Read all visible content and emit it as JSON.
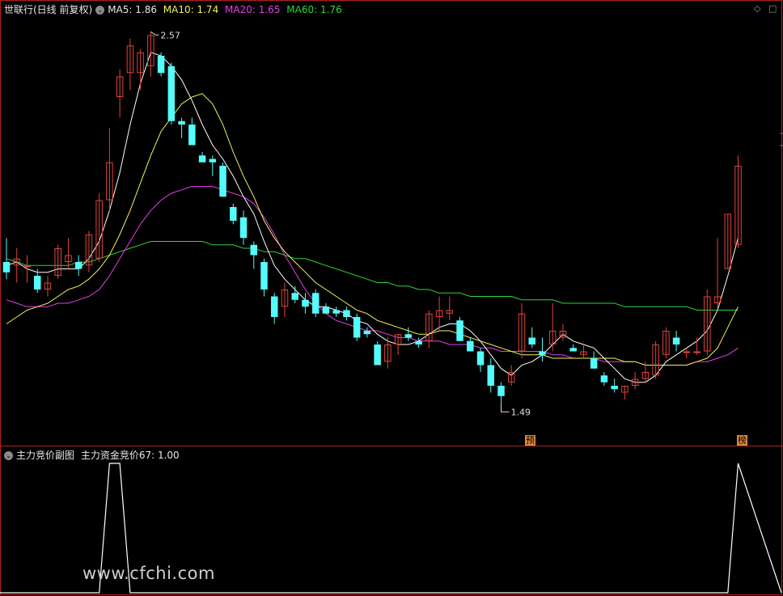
{
  "main_legend": {
    "title": "世联行(日线 前复权)",
    "ma5": "MA5: 1.86",
    "ma10": "MA10: 1.74",
    "ma20": "MA20: 1.65",
    "ma60": "MA60: 1.76"
  },
  "sub_legend": {
    "title": "主力竞价副图",
    "value": "主力资金竞价67: 1.00"
  },
  "annotations": {
    "high": "2.57",
    "low": "1.49",
    "tag_yu": "预",
    "tag_bang": "榜"
  },
  "watermark": "www.cfchi.com",
  "colors": {
    "up": "#e0443c",
    "down": "#54fcfc",
    "ma5": "#ffffff",
    "ma10": "#f2f25a",
    "ma20": "#e83ce8",
    "ma60": "#2ed63a",
    "border": "#b02020",
    "indicator": "#ffffff"
  },
  "chart_data": [
    {
      "type": "candlestick",
      "series_name": "世联行(日线 前复权)",
      "ohlc": [
        [
          1.9,
          1.97,
          1.85,
          1.87
        ],
        [
          1.89,
          1.94,
          1.84,
          1.91
        ],
        [
          1.89,
          1.92,
          1.84,
          1.89
        ],
        [
          1.86,
          1.88,
          1.81,
          1.82
        ],
        [
          1.82,
          1.86,
          1.8,
          1.84
        ],
        [
          1.86,
          1.95,
          1.85,
          1.94
        ],
        [
          1.9,
          1.97,
          1.88,
          1.92
        ],
        [
          1.9,
          1.92,
          1.86,
          1.88
        ],
        [
          1.89,
          1.99,
          1.87,
          1.98
        ],
        [
          1.91,
          2.1,
          1.9,
          2.08
        ],
        [
          2.08,
          2.29,
          2.05,
          2.19
        ],
        [
          2.38,
          2.46,
          2.32,
          2.44
        ],
        [
          2.45,
          2.55,
          2.4,
          2.53
        ],
        [
          2.45,
          2.52,
          2.4,
          2.51
        ],
        [
          2.47,
          2.57,
          2.44,
          2.56
        ],
        [
          2.5,
          2.51,
          2.44,
          2.45
        ],
        [
          2.47,
          2.48,
          2.3,
          2.31
        ],
        [
          2.31,
          2.32,
          2.26,
          2.3
        ],
        [
          2.3,
          2.32,
          2.25,
          2.24
        ],
        [
          2.21,
          2.22,
          2.2,
          2.19
        ],
        [
          2.2,
          2.21,
          2.15,
          2.19
        ],
        [
          2.18,
          2.19,
          2.09,
          2.09
        ],
        [
          2.06,
          2.07,
          2.01,
          2.02
        ],
        [
          2.03,
          2.05,
          1.95,
          1.97
        ],
        [
          1.95,
          1.96,
          1.88,
          1.92
        ],
        [
          1.9,
          1.91,
          1.8,
          1.82
        ],
        [
          1.8,
          1.81,
          1.72,
          1.74
        ],
        [
          1.77,
          1.84,
          1.74,
          1.82
        ],
        [
          1.81,
          1.83,
          1.78,
          1.79
        ],
        [
          1.79,
          1.81,
          1.75,
          1.77
        ],
        [
          1.81,
          1.82,
          1.74,
          1.75
        ],
        [
          1.77,
          1.78,
          1.75,
          1.75
        ],
        [
          1.76,
          1.77,
          1.74,
          1.75
        ],
        [
          1.76,
          1.77,
          1.73,
          1.74
        ],
        [
          1.74,
          1.75,
          1.67,
          1.68
        ],
        [
          1.7,
          1.71,
          1.68,
          1.69
        ],
        [
          1.66,
          1.67,
          1.6,
          1.6
        ],
        [
          1.61,
          1.68,
          1.59,
          1.66
        ],
        [
          1.66,
          1.69,
          1.63,
          1.69
        ],
        [
          1.69,
          1.71,
          1.67,
          1.68
        ],
        [
          1.67,
          1.68,
          1.65,
          1.66
        ],
        [
          1.67,
          1.76,
          1.65,
          1.75
        ],
        [
          1.74,
          1.8,
          1.7,
          1.76
        ],
        [
          1.75,
          1.8,
          1.73,
          1.76
        ],
        [
          1.73,
          1.74,
          1.67,
          1.67
        ],
        [
          1.67,
          1.68,
          1.64,
          1.64
        ],
        [
          1.64,
          1.65,
          1.58,
          1.6
        ],
        [
          1.6,
          1.62,
          1.52,
          1.54
        ],
        [
          1.54,
          1.55,
          1.49,
          1.51
        ],
        [
          1.55,
          1.6,
          1.54,
          1.58
        ],
        [
          1.64,
          1.78,
          1.62,
          1.75
        ],
        [
          1.68,
          1.71,
          1.65,
          1.66
        ],
        [
          1.64,
          1.68,
          1.61,
          1.63
        ],
        [
          1.66,
          1.78,
          1.64,
          1.7
        ],
        [
          1.68,
          1.72,
          1.67,
          1.7
        ],
        [
          1.65,
          1.66,
          1.64,
          1.64
        ],
        [
          1.63,
          1.66,
          1.62,
          1.64
        ],
        [
          1.62,
          1.64,
          1.59,
          1.59
        ],
        [
          1.57,
          1.58,
          1.54,
          1.55
        ],
        [
          1.54,
          1.56,
          1.52,
          1.53
        ],
        [
          1.52,
          1.54,
          1.5,
          1.54
        ],
        [
          1.54,
          1.58,
          1.53,
          1.56
        ],
        [
          1.56,
          1.61,
          1.55,
          1.58
        ],
        [
          1.57,
          1.67,
          1.56,
          1.66
        ],
        [
          1.63,
          1.71,
          1.62,
          1.7
        ],
        [
          1.68,
          1.7,
          1.64,
          1.66
        ],
        [
          1.64,
          1.65,
          1.62,
          1.64
        ],
        [
          1.64,
          1.68,
          1.63,
          1.64
        ],
        [
          1.64,
          1.82,
          1.63,
          1.8
        ],
        [
          1.78,
          1.97,
          1.76,
          1.8
        ],
        [
          1.88,
          2.04,
          1.88,
          2.04
        ],
        [
          1.95,
          2.21,
          1.94,
          2.18
        ]
      ],
      "ma5": [
        1.89,
        1.9,
        1.88,
        1.87,
        1.87,
        1.88,
        1.88,
        1.88,
        1.91,
        1.96,
        2.05,
        2.16,
        2.3,
        2.42,
        2.51,
        2.5,
        2.47,
        2.43,
        2.37,
        2.3,
        2.24,
        2.2,
        2.15,
        2.09,
        2.04,
        1.96,
        1.89,
        1.85,
        1.82,
        1.79,
        1.77,
        1.77,
        1.76,
        1.75,
        1.73,
        1.72,
        1.69,
        1.67,
        1.66,
        1.66,
        1.67,
        1.69,
        1.71,
        1.72,
        1.72,
        1.7,
        1.67,
        1.63,
        1.59,
        1.57,
        1.6,
        1.61,
        1.63,
        1.66,
        1.69,
        1.67,
        1.66,
        1.65,
        1.62,
        1.59,
        1.56,
        1.55,
        1.55,
        1.57,
        1.61,
        1.63,
        1.65,
        1.67,
        1.7,
        1.76,
        1.86,
        1.97
      ],
      "ma10": [
        1.72,
        1.74,
        1.76,
        1.77,
        1.78,
        1.8,
        1.82,
        1.83,
        1.85,
        1.88,
        1.92,
        1.98,
        2.05,
        2.13,
        2.21,
        2.28,
        2.32,
        2.36,
        2.38,
        2.39,
        2.36,
        2.3,
        2.22,
        2.15,
        2.09,
        2.02,
        1.97,
        1.93,
        1.9,
        1.87,
        1.84,
        1.82,
        1.8,
        1.78,
        1.76,
        1.75,
        1.73,
        1.72,
        1.71,
        1.7,
        1.69,
        1.69,
        1.7,
        1.7,
        1.69,
        1.68,
        1.67,
        1.66,
        1.65,
        1.64,
        1.63,
        1.63,
        1.63,
        1.62,
        1.62,
        1.62,
        1.62,
        1.62,
        1.62,
        1.62,
        1.61,
        1.61,
        1.6,
        1.6,
        1.6,
        1.6,
        1.6,
        1.61,
        1.62,
        1.65,
        1.71,
        1.77
      ],
      "ma20": [
        1.79,
        1.78,
        1.77,
        1.77,
        1.77,
        1.78,
        1.78,
        1.79,
        1.8,
        1.82,
        1.86,
        1.91,
        1.96,
        2.01,
        2.05,
        2.08,
        2.1,
        2.11,
        2.12,
        2.12,
        2.12,
        2.11,
        2.1,
        2.09,
        2.07,
        2.03,
        1.98,
        1.92,
        1.87,
        1.82,
        1.78,
        1.75,
        1.73,
        1.72,
        1.71,
        1.7,
        1.7,
        1.69,
        1.68,
        1.68,
        1.67,
        1.67,
        1.67,
        1.66,
        1.66,
        1.66,
        1.65,
        1.65,
        1.64,
        1.64,
        1.64,
        1.64,
        1.64,
        1.63,
        1.63,
        1.62,
        1.62,
        1.62,
        1.61,
        1.61,
        1.61,
        1.61,
        1.6,
        1.6,
        1.6,
        1.6,
        1.6,
        1.61,
        1.61,
        1.62,
        1.63,
        1.65
      ],
      "ma60": [
        1.91,
        1.9,
        1.89,
        1.89,
        1.89,
        1.89,
        1.89,
        1.9,
        1.9,
        1.91,
        1.92,
        1.93,
        1.94,
        1.95,
        1.96,
        1.96,
        1.96,
        1.96,
        1.96,
        1.96,
        1.95,
        1.95,
        1.95,
        1.94,
        1.94,
        1.93,
        1.93,
        1.92,
        1.91,
        1.91,
        1.9,
        1.89,
        1.88,
        1.87,
        1.86,
        1.85,
        1.84,
        1.84,
        1.83,
        1.83,
        1.82,
        1.82,
        1.81,
        1.81,
        1.81,
        1.8,
        1.8,
        1.8,
        1.8,
        1.8,
        1.79,
        1.79,
        1.79,
        1.79,
        1.78,
        1.78,
        1.78,
        1.78,
        1.78,
        1.78,
        1.77,
        1.77,
        1.77,
        1.77,
        1.77,
        1.77,
        1.77,
        1.76,
        1.76,
        1.76,
        1.76,
        1.76
      ],
      "ylim": [
        1.38,
        2.62
      ]
    },
    {
      "type": "line",
      "series_name": "主力资金竞价67",
      "values": [
        0,
        0,
        0,
        0,
        0,
        0,
        0,
        0,
        0,
        0,
        1,
        1,
        0,
        0,
        0,
        0,
        0,
        0,
        0,
        0,
        0,
        0,
        0,
        0,
        0,
        0,
        0,
        0,
        0,
        0,
        0,
        0,
        0,
        0,
        0,
        0,
        0,
        0,
        0,
        0,
        0,
        0,
        0,
        0,
        0,
        0,
        0,
        0,
        0,
        0,
        0,
        0,
        0,
        0,
        0,
        0,
        0,
        0,
        0,
        0,
        0,
        0,
        0,
        0,
        0,
        0,
        0,
        0,
        0,
        0,
        0,
        1
      ],
      "ylim": [
        0,
        1
      ]
    }
  ]
}
